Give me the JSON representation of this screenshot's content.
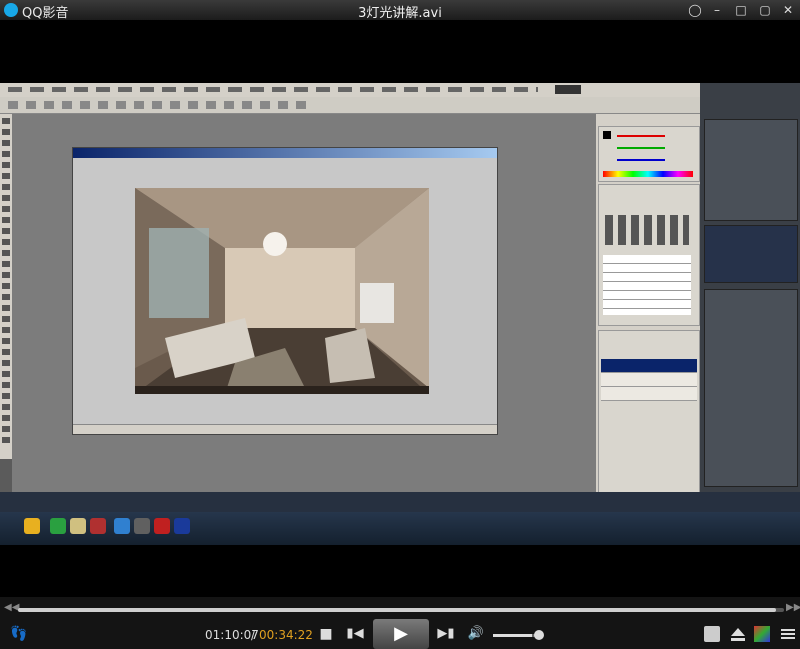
{
  "app": {
    "name": "QQ影音",
    "file_title": "3灯光讲解.avi"
  },
  "titlebar": {
    "icons": [
      "chat-icon",
      "minimize-icon",
      "restore-icon",
      "close-icon"
    ]
  },
  "video": {
    "content": "screen-recording-photoshop-3dsmax",
    "colors": {
      "accent": "#18a8e8"
    }
  },
  "playback": {
    "current_time": "01:10:07",
    "separator": " / ",
    "total_time": "00:34:22",
    "progress": 0.99,
    "volume": 0.85
  },
  "controls": {
    "buttons": [
      "stop-icon",
      "previous-icon",
      "play-icon",
      "next-icon",
      "volume-icon"
    ],
    "right_buttons": [
      "settings-icon",
      "eject-icon",
      "playlist-icon",
      "menu-icon"
    ]
  }
}
